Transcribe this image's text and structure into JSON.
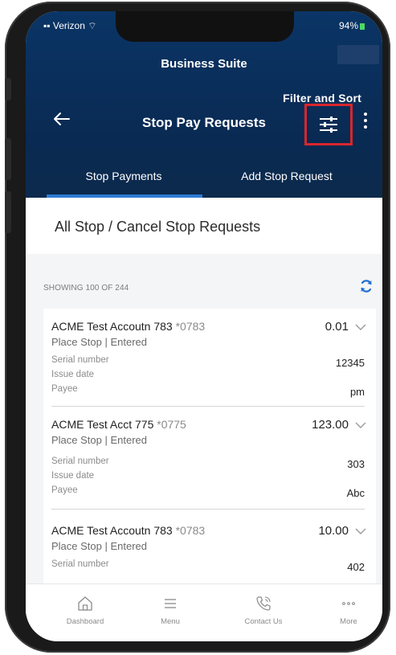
{
  "status_bar": {
    "carrier": "Verizon",
    "battery": "94%"
  },
  "app": {
    "title": "Business Suite"
  },
  "annotation": {
    "label": "Filter and Sort"
  },
  "header": {
    "page_title": "Stop Pay Requests"
  },
  "tabs": [
    {
      "label": "Stop Payments",
      "active": true
    },
    {
      "label": "Add Stop Request",
      "active": false
    }
  ],
  "section": {
    "title": "All Stop / Cancel Stop Requests"
  },
  "list": {
    "showing": "SHOWING 100 OF 244",
    "items": [
      {
        "account": "ACME Test Accoutn 783",
        "suffix": "*0783",
        "amount": "0.01",
        "status": "Place Stop | Entered",
        "serial_label": "Serial number",
        "serial": "12345",
        "issue_label": "Issue date",
        "issue": "",
        "payee_label": "Payee",
        "payee": "pm"
      },
      {
        "account": "ACME Test Acct 775",
        "suffix": "*0775",
        "amount": "123.00",
        "status": "Place Stop | Entered",
        "serial_label": "Serial number",
        "serial": "303",
        "issue_label": "Issue date",
        "issue": "",
        "payee_label": "Payee",
        "payee": "Abc"
      },
      {
        "account": "ACME Test Accoutn 783",
        "suffix": "*0783",
        "amount": "10.00",
        "status": "Place Stop | Entered",
        "serial_label": "Serial number",
        "serial": "402"
      }
    ]
  },
  "bottom_nav": [
    {
      "label": "Dashboard",
      "icon": "home-icon"
    },
    {
      "label": "Menu",
      "icon": "hamburger-icon"
    },
    {
      "label": "Contact Us",
      "icon": "phone-icon"
    },
    {
      "label": "More",
      "icon": "more-dots-icon"
    }
  ],
  "colors": {
    "header_bg": "#0a3566",
    "tab_underline": "#2f7bd6",
    "annotation_border": "#d9262c",
    "refresh_icon": "#1f6fd1"
  }
}
